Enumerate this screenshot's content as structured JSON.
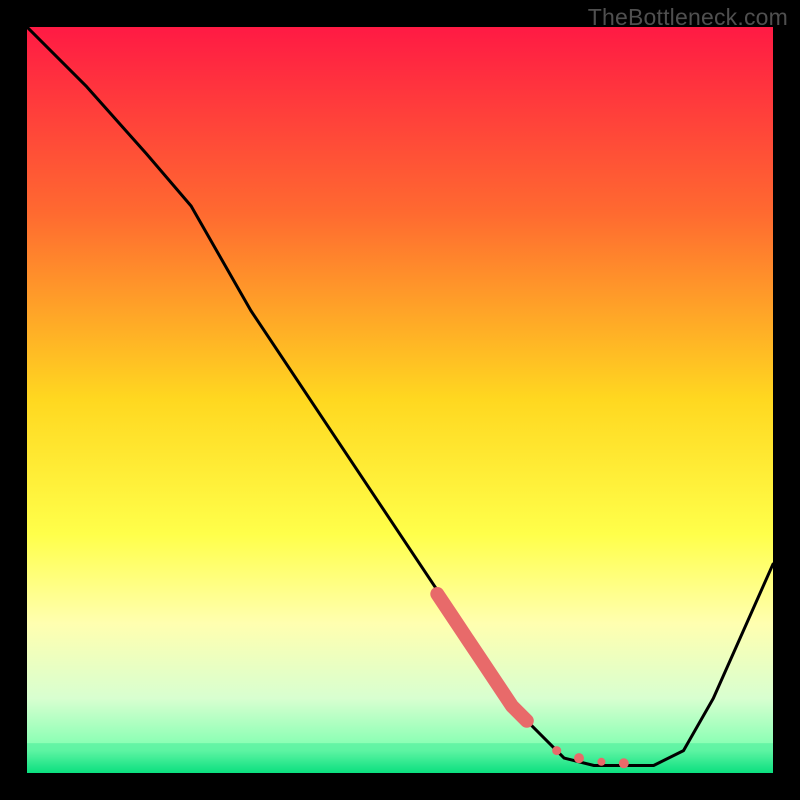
{
  "watermark": "TheBottleneck.com",
  "chart_data": {
    "type": "line",
    "title": "",
    "xlabel": "",
    "ylabel": "",
    "xlim": [
      0,
      100
    ],
    "ylim": [
      0,
      100
    ],
    "grid": false,
    "background_gradient": {
      "stops": [
        {
          "offset": 0.0,
          "color": "#ff1a44"
        },
        {
          "offset": 0.25,
          "color": "#ff6a30"
        },
        {
          "offset": 0.5,
          "color": "#ffd820"
        },
        {
          "offset": 0.68,
          "color": "#ffff4a"
        },
        {
          "offset": 0.8,
          "color": "#ffffb0"
        },
        {
          "offset": 0.9,
          "color": "#d8ffd0"
        },
        {
          "offset": 0.97,
          "color": "#7fffb0"
        },
        {
          "offset": 1.0,
          "color": "#00e07a"
        }
      ]
    },
    "series": [
      {
        "name": "curve",
        "color": "#000000",
        "x": [
          0,
          8,
          16,
          22,
          30,
          40,
          50,
          60,
          66,
          72,
          76,
          80,
          84,
          88,
          92,
          100
        ],
        "y": [
          100,
          92,
          83,
          76,
          62,
          47,
          32,
          17,
          8,
          2,
          1,
          1,
          1,
          3,
          10,
          28
        ]
      }
    ],
    "highlight_segments": [
      {
        "name": "thick-coral-segment",
        "color": "#e86a6a",
        "width": 14,
        "x": [
          55,
          57,
          59,
          61,
          63,
          65,
          67
        ],
        "y": [
          24,
          21,
          18,
          15,
          12,
          9,
          7
        ]
      }
    ],
    "highlight_points": [
      {
        "x": 71,
        "y": 3.0,
        "r": 4.5,
        "color": "#e86a6a"
      },
      {
        "x": 74,
        "y": 2.0,
        "r": 5.0,
        "color": "#e86a6a"
      },
      {
        "x": 77,
        "y": 1.5,
        "r": 4.0,
        "color": "#e86a6a"
      },
      {
        "x": 80,
        "y": 1.3,
        "r": 5.0,
        "color": "#e86a6a"
      }
    ],
    "green_band": {
      "y0": 0,
      "y1": 4
    }
  }
}
